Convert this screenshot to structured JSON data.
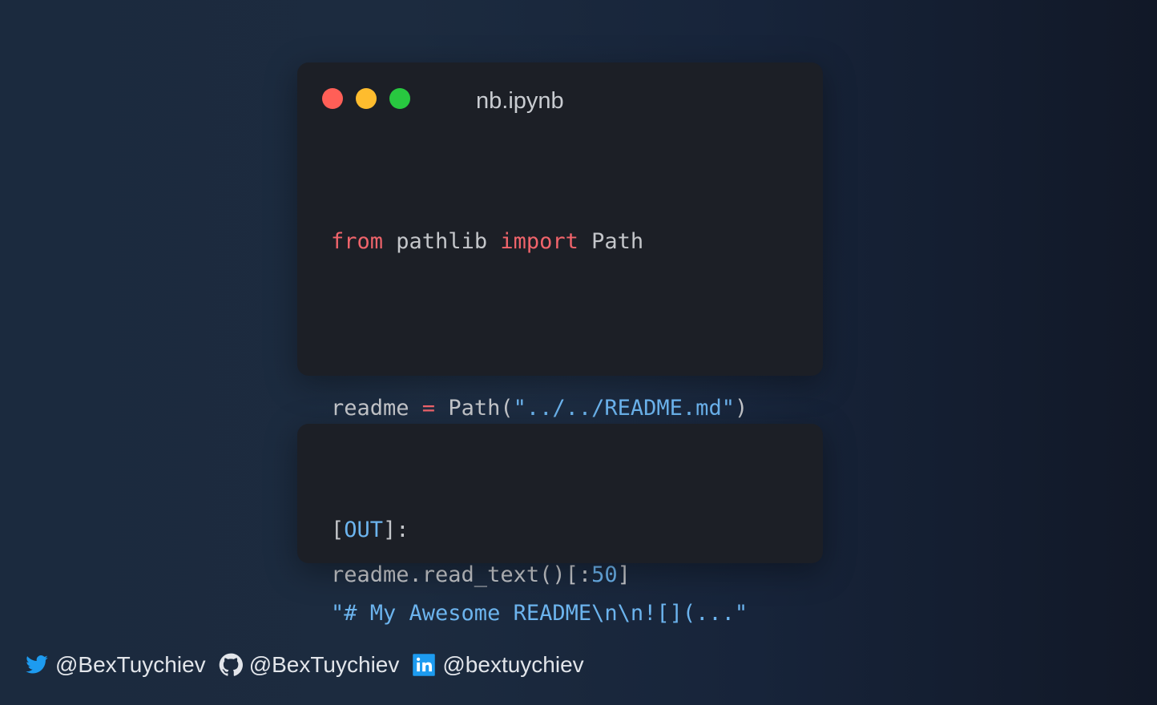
{
  "colors": {
    "background_left": "#1b2a3e",
    "background_right": "#111827",
    "card": "#1c1f26",
    "keyword": "#f0646b",
    "string": "#6cb4ee",
    "text": "#c4c6ca",
    "dot_red": "#ff5f57",
    "dot_yellow": "#febc2e",
    "dot_green": "#28c840",
    "twitter": "#1d9bf0",
    "linkedin": "#1d9bf0"
  },
  "window": {
    "title": "nb.ipynb",
    "controls": [
      "close",
      "minimize",
      "maximize"
    ]
  },
  "code_cell": {
    "line1": {
      "kw1": "from",
      "mod": " pathlib ",
      "kw2": "import",
      "name": " Path"
    },
    "line2": {
      "var": "readme ",
      "op": "=",
      "call": " Path(",
      "str": "\"../../README.md\"",
      "close": ")"
    },
    "line3": {
      "call": "readme.read_text()[:",
      "num": "50",
      "close": "]"
    }
  },
  "output_cell": {
    "label_open": "[",
    "label": "OUT",
    "label_close": "]:",
    "value": "\"# My Awesome README\\n\\n![](...\""
  },
  "footer": {
    "twitter": {
      "icon": "twitter-icon",
      "handle": "@BexTuychiev"
    },
    "github": {
      "icon": "github-icon",
      "handle": "@BexTuychiev"
    },
    "linkedin": {
      "icon": "linkedin-icon",
      "handle": "@bextuychiev"
    }
  }
}
